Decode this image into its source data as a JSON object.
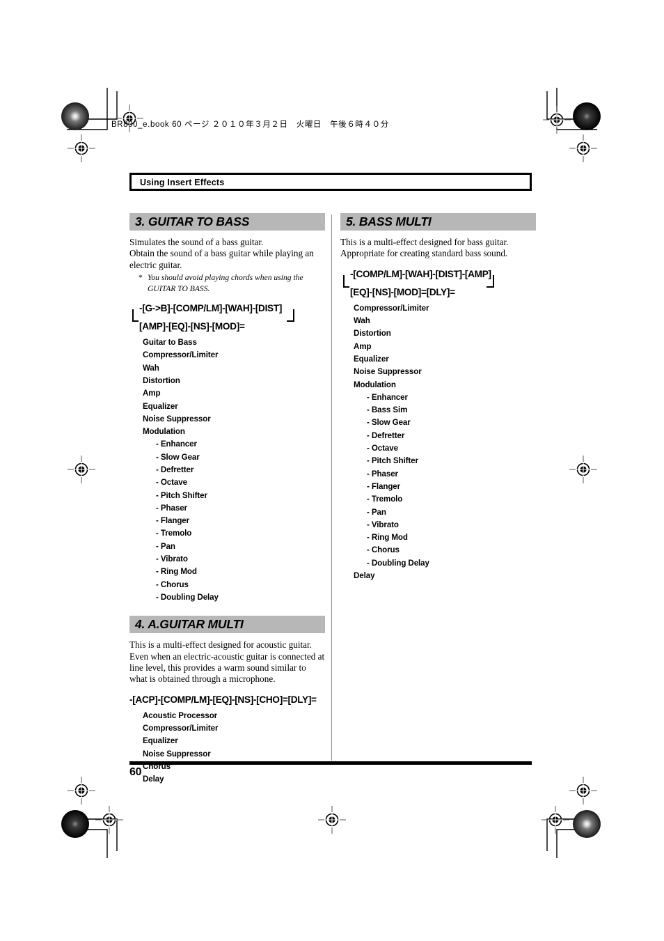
{
  "page": {
    "file_header": "BR800_e.book  60 ページ  ２０１０年３月２日　火曜日　午後６時４０分",
    "running_head": "Using Insert Effects",
    "page_number": "60"
  },
  "sections": {
    "guitar_to_bass": {
      "heading": "3. GUITAR TO BASS",
      "desc_line1": "Simulates the sound of a bass guitar.",
      "desc_line2": "Obtain the sound of a bass guitar while playing an electric guitar.",
      "note_mark": "*",
      "note_text": "You should avoid playing chords when using the GUITAR TO BASS.",
      "chain_row1": "-[G->B]-[COMP/LM]-[WAH]-[DIST]",
      "chain_row2": "[AMP]-[EQ]-[NS]-[MOD]=",
      "effects": [
        {
          "label": "Guitar to Bass",
          "sub": false
        },
        {
          "label": "Compressor/Limiter",
          "sub": false
        },
        {
          "label": "Wah",
          "sub": false
        },
        {
          "label": "Distortion",
          "sub": false
        },
        {
          "label": "Amp",
          "sub": false
        },
        {
          "label": "Equalizer",
          "sub": false
        },
        {
          "label": "Noise Suppressor",
          "sub": false
        },
        {
          "label": "Modulation",
          "sub": false
        },
        {
          "label": "- Enhancer",
          "sub": true
        },
        {
          "label": "- Slow Gear",
          "sub": true
        },
        {
          "label": "- Defretter",
          "sub": true
        },
        {
          "label": "- Octave",
          "sub": true
        },
        {
          "label": "- Pitch Shifter",
          "sub": true
        },
        {
          "label": "- Phaser",
          "sub": true
        },
        {
          "label": "- Flanger",
          "sub": true
        },
        {
          "label": "- Tremolo",
          "sub": true
        },
        {
          "label": "- Pan",
          "sub": true
        },
        {
          "label": "- Vibrato",
          "sub": true
        },
        {
          "label": "- Ring Mod",
          "sub": true
        },
        {
          "label": "- Chorus",
          "sub": true
        },
        {
          "label": "- Doubling Delay",
          "sub": true
        }
      ]
    },
    "a_guitar_multi": {
      "heading": "4. A.GUITAR MULTI",
      "desc_line1": "This is a multi-effect designed for acoustic guitar.",
      "desc_line2": "Even when an electric-acoustic guitar is connected at line level, this provides a warm sound similar to what is obtained through a microphone.",
      "chain_row1": "-[ACP]-[COMP/LM]-[EQ]-[NS]-[CHO]=[DLY]=",
      "effects": [
        {
          "label": "Acoustic Processor",
          "sub": false
        },
        {
          "label": "Compressor/Limiter",
          "sub": false
        },
        {
          "label": "Equalizer",
          "sub": false
        },
        {
          "label": "Noise Suppressor",
          "sub": false
        },
        {
          "label": "Chorus",
          "sub": false
        },
        {
          "label": "Delay",
          "sub": false
        }
      ]
    },
    "bass_multi": {
      "heading": "5. BASS MULTI",
      "desc_line1": "This is a multi-effect designed for bass guitar.",
      "desc_line2": "Appropriate for creating standard bass sound.",
      "chain_row1": "-[COMP/LM]-[WAH]-[DIST]-[AMP]",
      "chain_row2": "[EQ]-[NS]-[MOD]=[DLY]=",
      "effects": [
        {
          "label": "Compressor/Limiter",
          "sub": false
        },
        {
          "label": "Wah",
          "sub": false
        },
        {
          "label": "Distortion",
          "sub": false
        },
        {
          "label": "Amp",
          "sub": false
        },
        {
          "label": "Equalizer",
          "sub": false
        },
        {
          "label": "Noise Suppressor",
          "sub": false
        },
        {
          "label": "Modulation",
          "sub": false
        },
        {
          "label": "- Enhancer",
          "sub": true
        },
        {
          "label": "- Bass Sim",
          "sub": true
        },
        {
          "label": "- Slow Gear",
          "sub": true
        },
        {
          "label": "- Defretter",
          "sub": true
        },
        {
          "label": "- Octave",
          "sub": true
        },
        {
          "label": "- Pitch Shifter",
          "sub": true
        },
        {
          "label": "- Phaser",
          "sub": true
        },
        {
          "label": "- Flanger",
          "sub": true
        },
        {
          "label": "- Tremolo",
          "sub": true
        },
        {
          "label": "- Pan",
          "sub": true
        },
        {
          "label": "- Vibrato",
          "sub": true
        },
        {
          "label": "- Ring Mod",
          "sub": true
        },
        {
          "label": "- Chorus",
          "sub": true
        },
        {
          "label": "- Doubling Delay",
          "sub": true
        },
        {
          "label": "Delay",
          "sub": false
        }
      ]
    }
  },
  "colors": {
    "section_bar": "#b7b7b7",
    "rule": "#000000",
    "divider": "#8d8d8d"
  }
}
